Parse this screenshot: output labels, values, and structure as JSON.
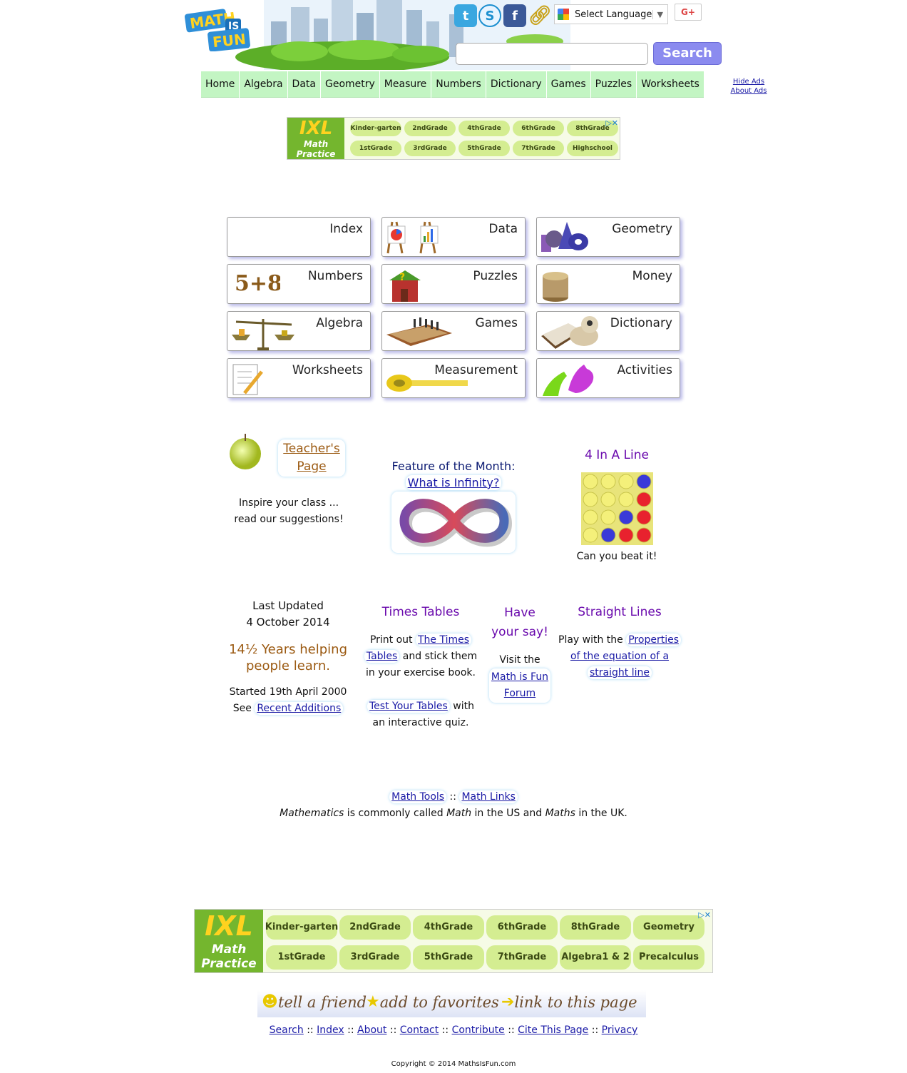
{
  "header": {
    "logo_text": [
      "MATH",
      "IS",
      "FUN"
    ],
    "social": [
      "twitter-icon",
      "stumbleupon-icon",
      "facebook-icon",
      "link-icon"
    ],
    "language_label": "Select Language",
    "gplus_label": "G+",
    "search_button": "Search",
    "search_placeholder": ""
  },
  "nav": {
    "items": [
      "Home",
      "Algebra",
      "Data",
      "Geometry",
      "Measure",
      "Numbers",
      "Dictionary",
      "Games",
      "Puzzles",
      "Worksheets"
    ],
    "hide_ads": "Hide Ads",
    "about_ads": "About Ads"
  },
  "ad_top": {
    "logo": "IXL",
    "sub": "Math Practice",
    "grades_row1": [
      [
        "Kinder-",
        "garten"
      ],
      [
        "2nd",
        "Grade"
      ],
      [
        "4th",
        "Grade"
      ],
      [
        "6th",
        "Grade"
      ],
      [
        "8th",
        "Grade"
      ]
    ],
    "grades_row2": [
      [
        "1st",
        "Grade"
      ],
      [
        "3rd",
        "Grade"
      ],
      [
        "5th",
        "Grade"
      ],
      [
        "7th",
        "Grade"
      ],
      [
        "High",
        "school"
      ]
    ]
  },
  "categories": [
    [
      "Index",
      "Data",
      "Geometry"
    ],
    [
      "Numbers",
      "Puzzles",
      "Money"
    ],
    [
      "Algebra",
      "Games",
      "Dictionary"
    ],
    [
      "Worksheets",
      "Measurement",
      "Activities"
    ]
  ],
  "numbers_img": "5+8",
  "teacher": {
    "link": [
      "Teacher's",
      "Page"
    ],
    "line1": "Inspire your class ...",
    "line2": "read our suggestions!"
  },
  "feature": {
    "title": "Feature of the Month:",
    "link": "What is Infinity?"
  },
  "four_in_line": {
    "title": "4 In A Line",
    "caption": "Can you beat it!"
  },
  "updated": {
    "label": "Last Updated",
    "date": "4 October 2014",
    "years_line1": "14½ Years helping",
    "years_line2": "people learn.",
    "started": "Started 19th April 2000",
    "see": "See",
    "recent": "Recent Additions"
  },
  "times_tables": {
    "title": "Times Tables",
    "print_out": "Print out",
    "link1a": "The Times",
    "link1b": "Tables",
    "stick": "and stick them",
    "exercise": "in your exercise book.",
    "test_link": "Test Your Tables",
    "with": "with",
    "quiz": "an interactive quiz."
  },
  "have_say": {
    "title1": "Have",
    "title2": "your say!",
    "visit": "Visit the",
    "link1": "Math is Fun",
    "link2": "Forum"
  },
  "straight_lines": {
    "title": "Straight Lines",
    "play": "Play with the",
    "link1": "Properties",
    "link2": "of the equation of a",
    "link3": "straight line"
  },
  "bottom_links": {
    "math_tools": "Math Tools",
    "sep": "::",
    "math_links": "Math Links",
    "sentence": [
      "Mathematics",
      " is commonly called ",
      "Math",
      " in the US and ",
      "Maths",
      " in the UK."
    ]
  },
  "ad_bottom": {
    "logo": "IXL",
    "sub1": "Math",
    "sub2": "Practice",
    "row1": [
      [
        "Kinder-",
        "garten"
      ],
      [
        "2nd",
        "Grade"
      ],
      [
        "4th",
        "Grade"
      ],
      [
        "6th",
        "Grade"
      ],
      [
        "8th",
        "Grade"
      ],
      [
        "Geometry",
        ""
      ]
    ],
    "row2": [
      [
        "1st",
        "Grade"
      ],
      [
        "3rd",
        "Grade"
      ],
      [
        "5th",
        "Grade"
      ],
      [
        "7th",
        "Grade"
      ],
      [
        "Algebra",
        "1 & 2"
      ],
      [
        "Precalculus",
        ""
      ]
    ]
  },
  "footer": {
    "tell_friend": "tell a friend",
    "add_fav": "add to favorites",
    "link_page": "link to this page",
    "links": [
      "Search",
      "Index",
      "About",
      "Contact",
      "Contribute",
      "Cite This Page",
      "Privacy"
    ],
    "copyright": "Copyright © 2014 MathsIsFun.com"
  },
  "colors": {
    "nav_bg": "#c3f5c3",
    "search_btn": "#8b8bef",
    "title_purple": "#6a0aad",
    "brown": "#9b5a12",
    "link": "#1a1aa6",
    "ixl_green": "#74b62e"
  }
}
